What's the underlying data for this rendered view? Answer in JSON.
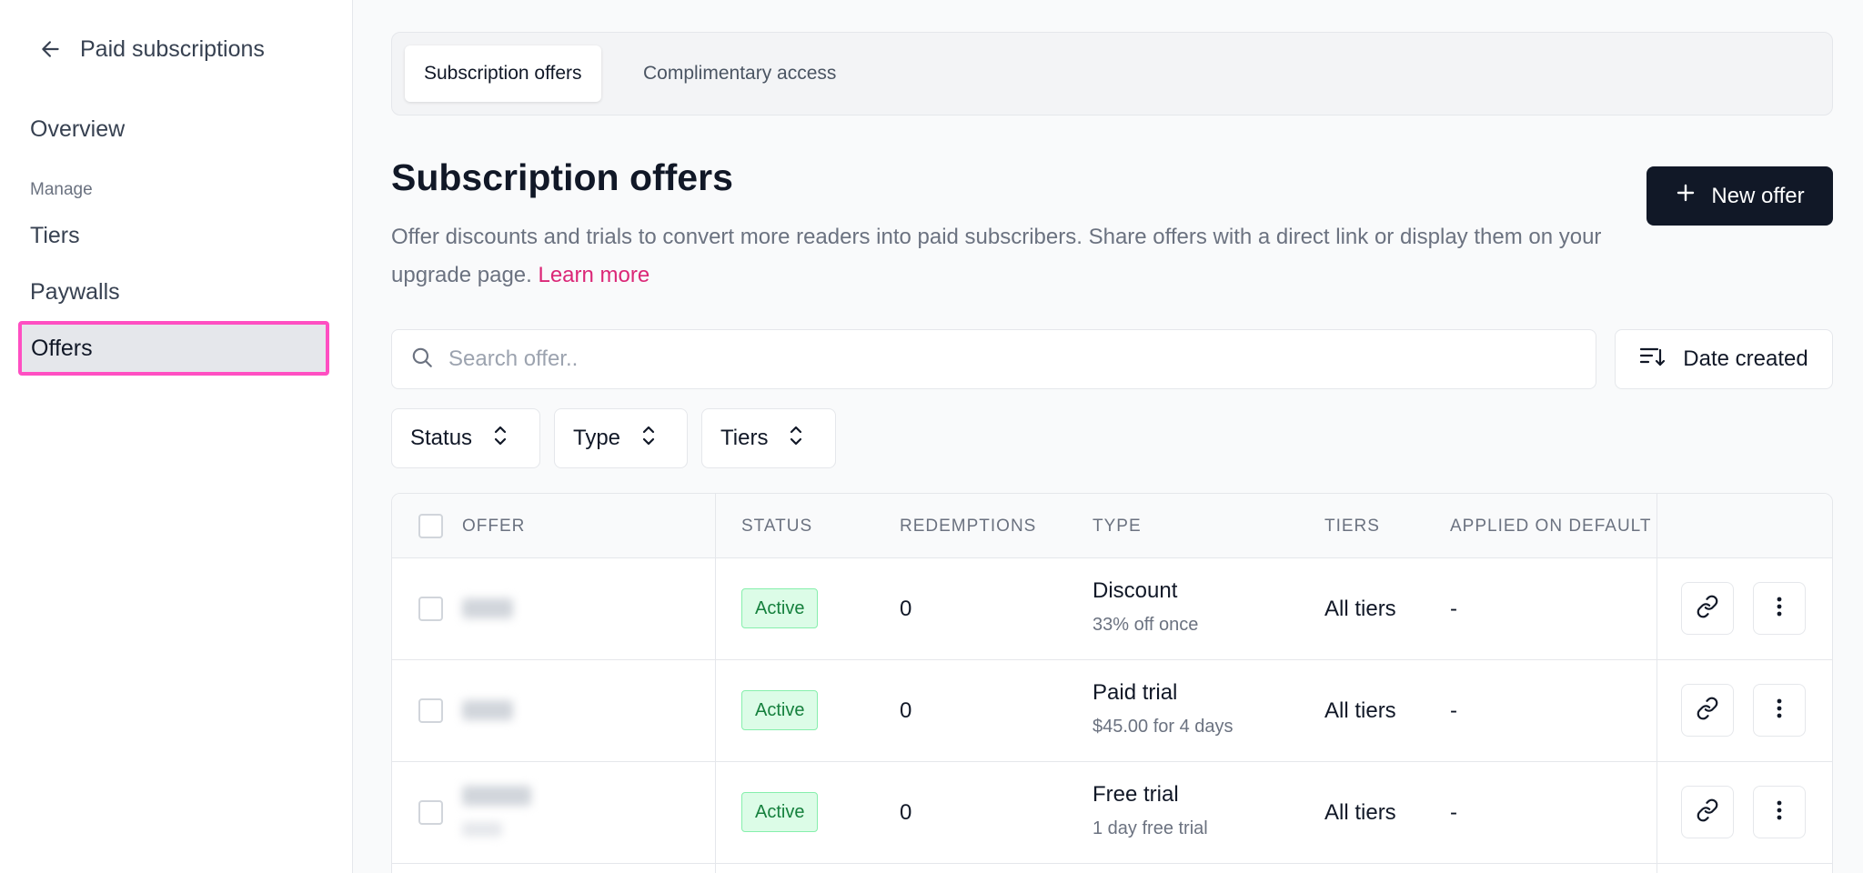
{
  "sidebar": {
    "back_label": "Paid subscriptions",
    "overview": "Overview",
    "section_label": "Manage",
    "items": [
      "Tiers",
      "Paywalls",
      "Offers"
    ],
    "active_item": "Offers"
  },
  "tabs": [
    {
      "label": "Subscription offers",
      "active": true
    },
    {
      "label": "Complimentary access",
      "active": false
    }
  ],
  "page": {
    "title": "Subscription offers",
    "description": "Offer discounts and trials to convert more readers into paid subscribers. Share offers with a direct link or display them on your upgrade page.",
    "learn_more": "Learn more",
    "new_offer_label": "New offer"
  },
  "search": {
    "placeholder": "Search offer..",
    "value": ""
  },
  "sort": {
    "label": "Date created"
  },
  "filters": [
    "Status",
    "Type",
    "Tiers"
  ],
  "table": {
    "columns": [
      "Offer",
      "Status",
      "Redemptions",
      "Type",
      "Tiers",
      "Applied on default"
    ],
    "rows": [
      {
        "status": "Active",
        "redemptions": "0",
        "type": "Discount",
        "type_detail": "33% off once",
        "tiers": "All tiers",
        "applied": "-"
      },
      {
        "status": "Active",
        "redemptions": "0",
        "type": "Paid trial",
        "type_detail": "$45.00 for 4 days",
        "tiers": "All tiers",
        "applied": "-"
      },
      {
        "status": "Active",
        "redemptions": "0",
        "type": "Free trial",
        "type_detail": "1 day free trial",
        "tiers": "All tiers",
        "applied": "-"
      }
    ]
  },
  "colors": {
    "accent": "#db2777",
    "primary_button": "#111827",
    "active_badge": "#dcfce7",
    "highlight": "#ff4fc2"
  },
  "icons": [
    "arrow-left-icon",
    "plus-icon",
    "search-icon",
    "sort-icon",
    "chevron-updown-icon",
    "link-icon",
    "more-vertical-icon"
  ]
}
